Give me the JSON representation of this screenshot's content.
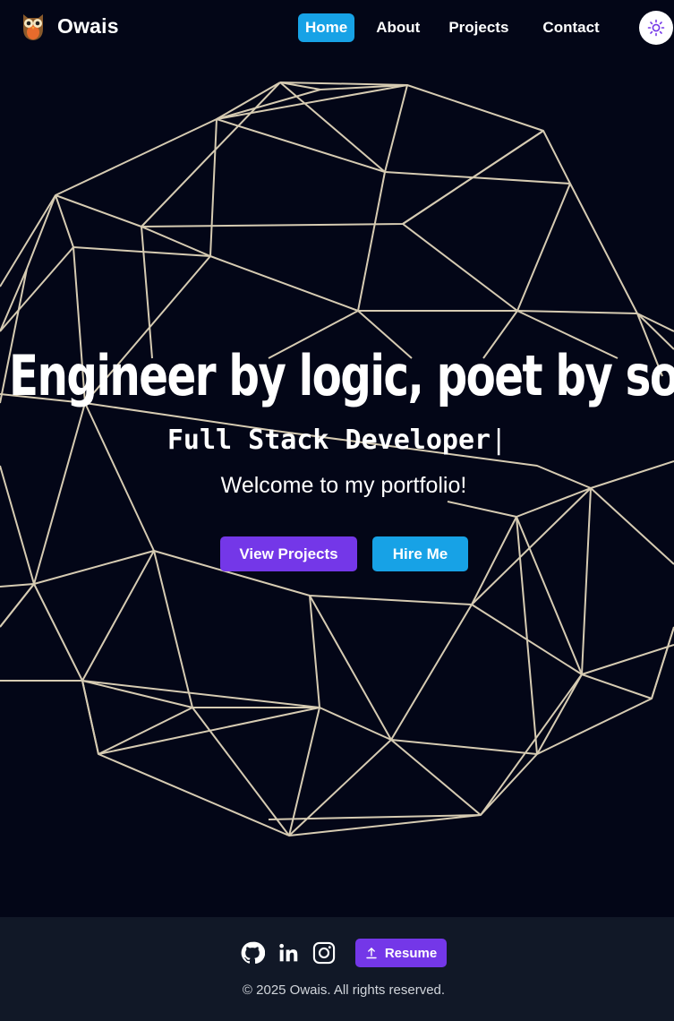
{
  "header": {
    "brand_name": "Owais",
    "logo_icon": "owl-icon",
    "nav": [
      {
        "label": "Home",
        "active": true
      },
      {
        "label": "About",
        "active": false
      },
      {
        "label": "Projects",
        "active": false
      },
      {
        "label": "Contact",
        "active": false
      }
    ],
    "theme_toggle_icon": "sun-icon"
  },
  "hero": {
    "title": "Engineer by logic, poet by soul",
    "role": "Full Stack Developer",
    "cursor": "|",
    "welcome": "Welcome to my portfolio!",
    "buttons": {
      "view_projects": "View Projects",
      "hire_me": "Hire Me"
    }
  },
  "footer": {
    "social_icons": [
      "github-icon",
      "linkedin-icon",
      "instagram-icon"
    ],
    "resume_label": "Resume",
    "resume_icon": "upload-icon",
    "copyright": "© 2025 Owais. All rights reserved."
  },
  "colors": {
    "background": "#030617",
    "footer_background": "#111827",
    "accent_blue": "#17a2e6",
    "accent_purple": "#7437e8",
    "mesh_line": "#e8dcc0"
  }
}
